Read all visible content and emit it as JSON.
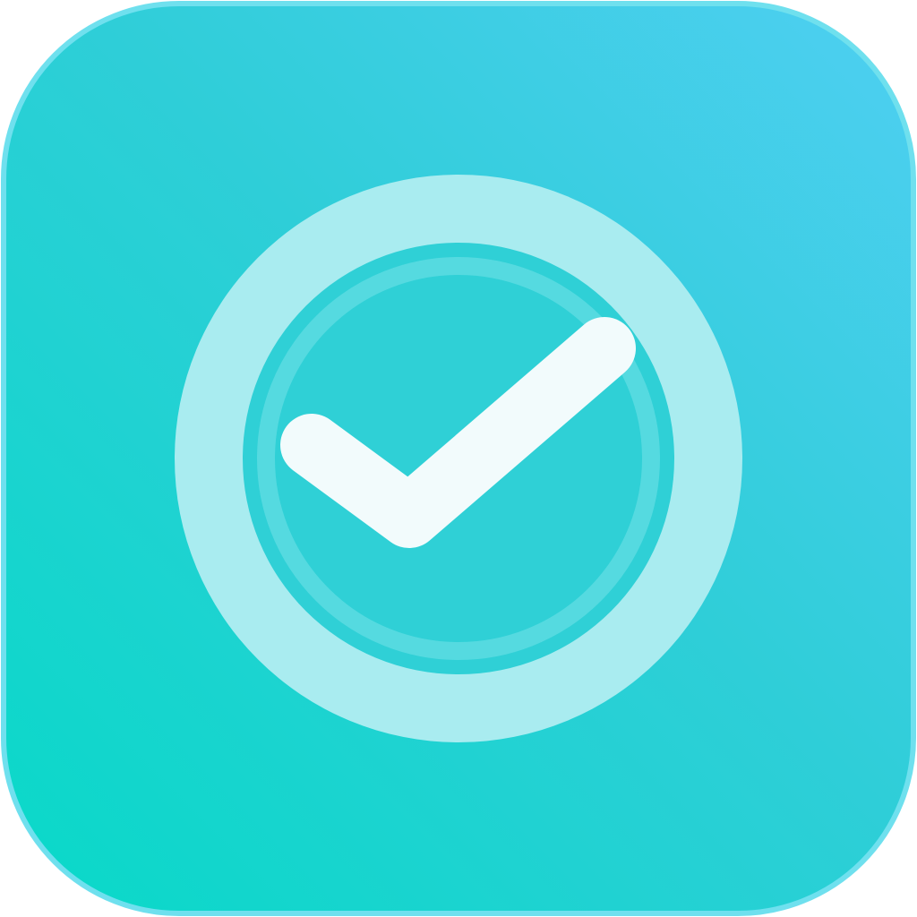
{
  "icon": {
    "name": "checkmark-circle-app-icon",
    "colors": {
      "gradient_start": "#08D9C8",
      "gradient_mid": "#2FCED8",
      "gradient_end": "#4FCFF2",
      "border": "#6FE0EE",
      "outer_ring": "#A9ECF0",
      "inner_disc": "#2FD0D6",
      "inner_ring": "#5CDCE2",
      "checkmark": "#F2FBFC"
    }
  }
}
